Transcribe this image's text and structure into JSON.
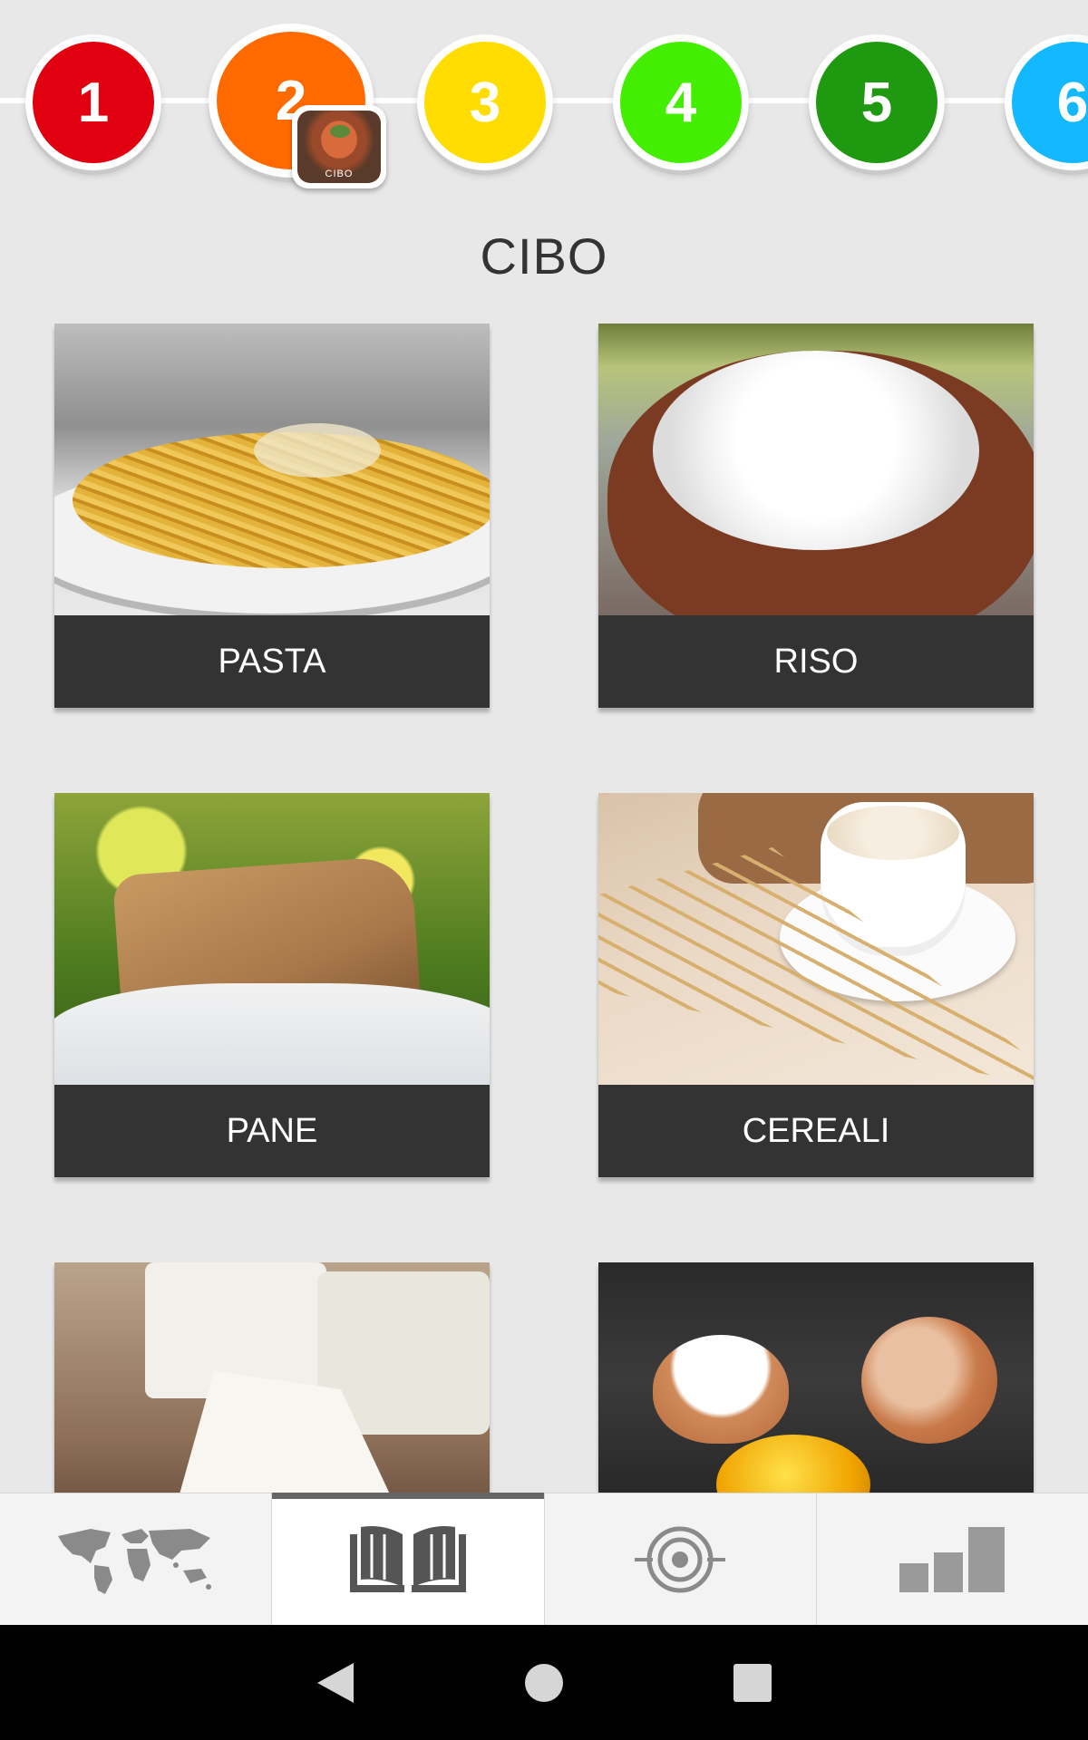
{
  "levels": [
    {
      "number": "1",
      "color": "#e00010"
    },
    {
      "number": "2",
      "color": "#ff6a00",
      "current": true
    },
    {
      "number": "3",
      "color": "#ffdd00"
    },
    {
      "number": "4",
      "color": "#44ee00"
    },
    {
      "number": "5",
      "color": "#1f9a10"
    },
    {
      "number": "6",
      "color": "#14b8ff"
    }
  ],
  "current_badge": {
    "label": "CIBO"
  },
  "page": {
    "title": "CIBO"
  },
  "cards": [
    {
      "label": "PASTA",
      "image": "pasta"
    },
    {
      "label": "RISO",
      "image": "rice"
    },
    {
      "label": "PANE",
      "image": "bread"
    },
    {
      "label": "CEREALI",
      "image": "cereal"
    },
    {
      "label": "",
      "image": "cheese"
    },
    {
      "label": "",
      "image": "eggs"
    }
  ],
  "tabbar": {
    "tabs": [
      {
        "icon": "world-map-icon"
      },
      {
        "icon": "book-icon",
        "active": true
      },
      {
        "icon": "target-icon"
      },
      {
        "icon": "bar-chart-icon"
      }
    ]
  },
  "system_nav": [
    "back-icon",
    "home-icon",
    "recents-icon"
  ]
}
